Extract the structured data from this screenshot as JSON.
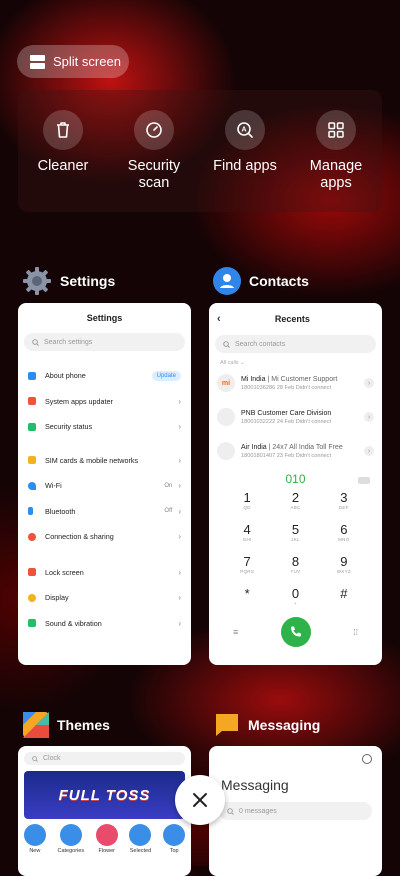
{
  "split_screen": {
    "label": "Split screen"
  },
  "quick_actions": [
    {
      "label": "Cleaner",
      "icon": "trash-icon"
    },
    {
      "label": "Security\nscan",
      "icon": "security-scan-icon"
    },
    {
      "label": "Find apps",
      "icon": "find-apps-icon"
    },
    {
      "label": "Manage\napps",
      "icon": "grid-icon"
    }
  ],
  "apps": {
    "settings": {
      "name": "Settings"
    },
    "contacts": {
      "name": "Contacts"
    },
    "themes": {
      "name": "Themes"
    },
    "messaging": {
      "name": "Messaging"
    }
  },
  "settings_card": {
    "title": "Settings",
    "search_placeholder": "Search settings",
    "items": [
      {
        "label": "About phone",
        "badge": "Update",
        "color": "#2c8df0"
      },
      {
        "label": "System apps updater",
        "color": "#f0533b"
      },
      {
        "label": "Security status",
        "color": "#1fbf6a"
      },
      {
        "label": "SIM cards & mobile networks",
        "color": "#f3b21f"
      },
      {
        "label": "Wi-Fi",
        "value": "On",
        "color": "#2c8df0"
      },
      {
        "label": "Bluetooth",
        "value": "Off",
        "color": "#2c8df0"
      },
      {
        "label": "Connection & sharing",
        "color": "#f0533b"
      },
      {
        "label": "Lock screen",
        "color": "#f0533b"
      },
      {
        "label": "Display",
        "color": "#f3b21f"
      },
      {
        "label": "Sound & vibration",
        "color": "#1fbf6a"
      }
    ]
  },
  "contacts_card": {
    "title": "Recents",
    "search_placeholder": "Search contacts",
    "filter": "All calls",
    "recents": [
      {
        "name": "Mi India",
        "detail": "Mi Customer Support",
        "sub": "18001036286 28 Feb Didn't connect",
        "avatar": "mi"
      },
      {
        "name": "PNB Customer Care Division",
        "detail": "",
        "sub": "18001032222 24 Feb Didn't connect",
        "avatar": ""
      },
      {
        "name": "Air India",
        "detail": "24x7 All India Toll Free",
        "sub": "18001801407 23 Feb Didn't connect",
        "avatar": ""
      }
    ],
    "dialed": "010",
    "keys": [
      {
        "d": "1",
        "l": "QD"
      },
      {
        "d": "2",
        "l": "ABC"
      },
      {
        "d": "3",
        "l": "DEF"
      },
      {
        "d": "4",
        "l": "GHI"
      },
      {
        "d": "5",
        "l": "JKL"
      },
      {
        "d": "6",
        "l": "MNO"
      },
      {
        "d": "7",
        "l": "PQRS"
      },
      {
        "d": "8",
        "l": "TUV"
      },
      {
        "d": "9",
        "l": "WXYZ"
      },
      {
        "d": "*",
        "l": ""
      },
      {
        "d": "0",
        "l": "+"
      },
      {
        "d": "#",
        "l": ""
      }
    ]
  },
  "themes_card": {
    "search_placeholder": "Clock",
    "banner": "FULL TOSS",
    "tabs": [
      "New",
      "Categories",
      "Flower",
      "Selected",
      "Top"
    ]
  },
  "messaging_card": {
    "title": "Messaging",
    "search_placeholder": "0 messages"
  }
}
